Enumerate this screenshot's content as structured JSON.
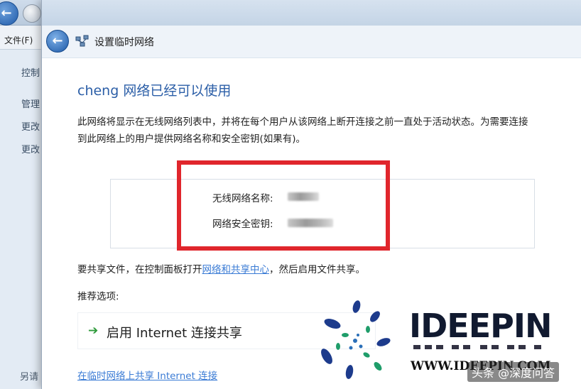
{
  "background": {
    "menu_label": "文件(F)",
    "sidebar_items": [
      "控制",
      "管理",
      "更改",
      "更改"
    ],
    "bottom_label": "另请"
  },
  "dialog": {
    "title": "设置临时网络",
    "heading": "cheng 网络已经可以使用",
    "description": "此网络将显示在无线网络列表中，并将在每个用户从该网络上断开连接之前一直处于活动状态。为需要连接到此网络上的用户提供网络名称和安全密钥(如果有)。",
    "network_name_label": "无线网络名称:",
    "security_key_label": "网络安全密钥:",
    "share_prefix": "要共享文件，在控制面板打开",
    "share_link": "网络和共享中心",
    "share_suffix": "，然后启用文件共享。",
    "recommended_label": "推荐选项:",
    "option_label": "启用 Internet 连接共享",
    "bottom_link": "在临时网络上共享 Internet 连接"
  },
  "watermark": {
    "brand": "IDEEPIN",
    "site": "WWW.IDEEPIN.COM",
    "caption": "头条 @深度问答"
  },
  "colors": {
    "accent_blue": "#2b5ea7",
    "link_blue": "#3a7bd5",
    "highlight_red": "#e0262c",
    "arrow_green": "#2e9a3a"
  }
}
